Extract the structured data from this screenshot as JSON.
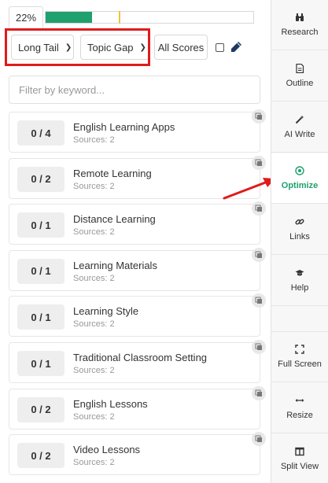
{
  "header": {
    "score_percent_label": "22%",
    "progress": {
      "fill_fraction": 0.22,
      "marker_fraction": 0.35
    }
  },
  "filters": {
    "type_select": "Long Tail",
    "topic_select": "Topic Gap",
    "all_scores_label": "All Scores",
    "keyword_placeholder": "Filter by keyword..."
  },
  "keywords": [
    {
      "score": "0 / 4",
      "keyword": "English Learning Apps",
      "sources": "Sources: 2"
    },
    {
      "score": "0 / 2",
      "keyword": "Remote Learning",
      "sources": "Sources: 2"
    },
    {
      "score": "0 / 1",
      "keyword": "Distance Learning",
      "sources": "Sources: 2"
    },
    {
      "score": "0 / 1",
      "keyword": "Learning Materials",
      "sources": "Sources: 2"
    },
    {
      "score": "0 / 1",
      "keyword": "Learning Style",
      "sources": "Sources: 2"
    },
    {
      "score": "0 / 1",
      "keyword": "Traditional Classroom Setting",
      "sources": "Sources: 2"
    },
    {
      "score": "0 / 2",
      "keyword": "English Lessons",
      "sources": "Sources: 2"
    },
    {
      "score": "0 / 2",
      "keyword": "Video Lessons",
      "sources": "Sources: 2"
    }
  ],
  "sidebar": {
    "items": [
      {
        "label": "Research",
        "icon": "binoculars-icon"
      },
      {
        "label": "Outline",
        "icon": "document-icon"
      },
      {
        "label": "AI Write",
        "icon": "magic-wand-icon"
      },
      {
        "label": "Optimize",
        "icon": "target-icon"
      },
      {
        "label": "Links",
        "icon": "link-icon"
      },
      {
        "label": "Help",
        "icon": "graduation-cap-icon"
      },
      {
        "label": "Full Screen",
        "icon": "fullscreen-icon"
      },
      {
        "label": "Resize",
        "icon": "resize-arrows-icon"
      },
      {
        "label": "Split View",
        "icon": "split-view-icon"
      }
    ]
  },
  "colors": {
    "accent": "#1fa06e",
    "annotation": "#e01b1b",
    "marker": "#f0c040"
  }
}
